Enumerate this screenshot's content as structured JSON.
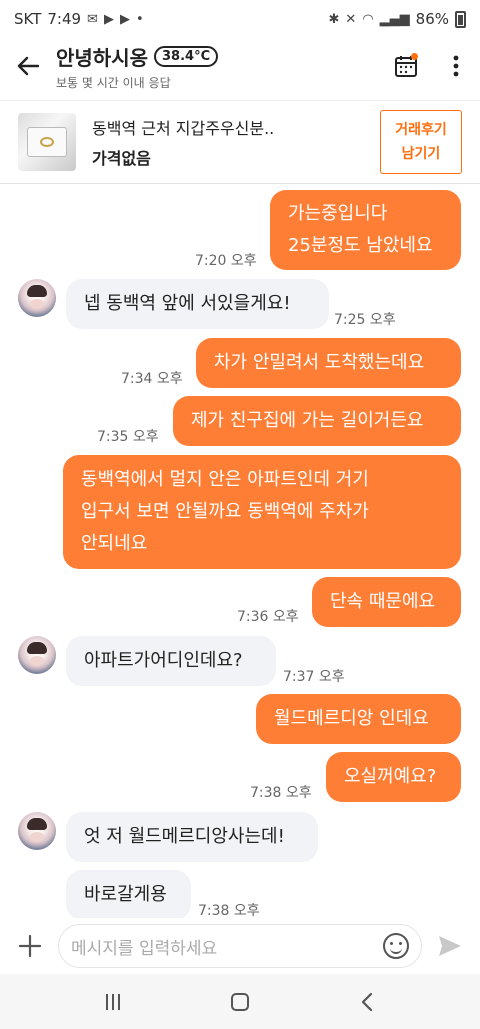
{
  "status_bar": {
    "carrier": "SKT",
    "time": "7:49",
    "extra_dot": "•",
    "battery": "86%"
  },
  "header": {
    "back_icon": "arrow-left-icon",
    "title": "안녕하시옹",
    "temperature": "38.4°C",
    "subtitle": "보통 몇 시간 이내 응답",
    "calendar_icon": "calendar-icon",
    "menu_icon": "more-vertical-icon"
  },
  "product": {
    "title": "동백역 근처 지갑주우신분..",
    "price": "가격없음",
    "review_button_line1": "거래후기",
    "review_button_line2": "남기기"
  },
  "messages": [
    {
      "sender": "me",
      "lines": [
        "가는중입니다",
        "25분정도 남았네요"
      ],
      "time": "7:20 오후"
    },
    {
      "sender": "them",
      "lines": [
        "넵 동백역 앞에 서있을게요!"
      ],
      "time": "7:25 오후"
    },
    {
      "sender": "me",
      "lines": [
        "차가 안밀려서 도착했는데요"
      ],
      "time": "7:34 오후"
    },
    {
      "sender": "me",
      "lines": [
        "제가 친구집에 가는 길이거든요"
      ],
      "time": "7:35 오후"
    },
    {
      "sender": "me",
      "lines": [
        "동백역에서 멀지 안은 아파트인데 거기",
        "입구서 보면 안될까요 동백역에 주차가",
        "안되네요"
      ],
      "time": ""
    },
    {
      "sender": "me",
      "lines": [
        "단속 때문에요"
      ],
      "time": "7:36 오후"
    },
    {
      "sender": "them",
      "lines": [
        "아파트가어디인데요?"
      ],
      "time": "7:37 오후"
    },
    {
      "sender": "me",
      "lines": [
        "월드메르디앙 인데요"
      ],
      "time": ""
    },
    {
      "sender": "me",
      "lines": [
        "오실꺼예요?"
      ],
      "time": "7:38 오후"
    },
    {
      "sender": "them",
      "lines": [
        "엇 저 월드메르디앙사는데!"
      ],
      "time": ""
    },
    {
      "sender": "them",
      "lines": [
        "바로갈게용"
      ],
      "time": "7:38 오후"
    }
  ],
  "input_bar": {
    "plus_icon": "plus-icon",
    "placeholder": "메시지를 입력하세요",
    "emoji_icon": "smiley-icon",
    "send_icon": "send-icon"
  },
  "colors": {
    "accent": "#ff6f0f",
    "my_bubble": "#ff7e36",
    "their_bubble": "#f2f3f6"
  }
}
